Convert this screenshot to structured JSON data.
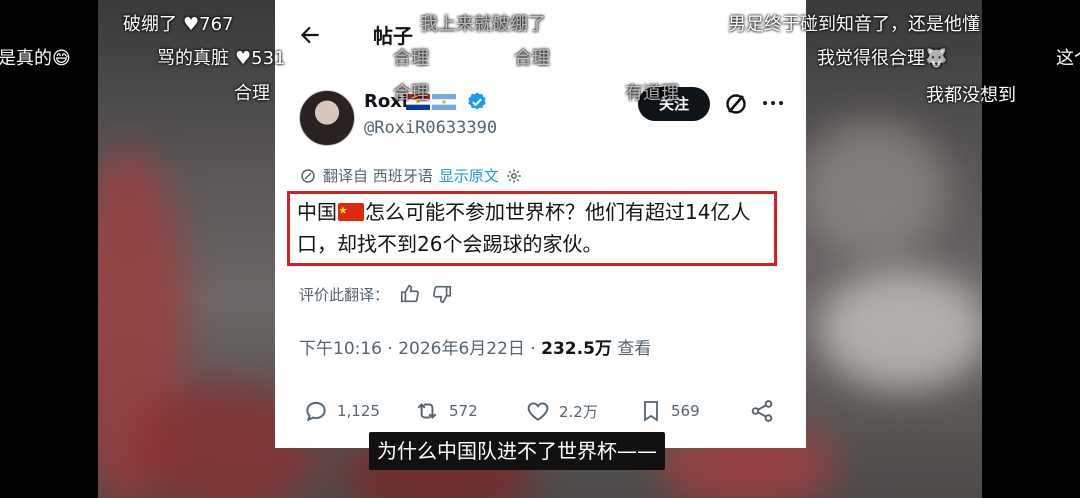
{
  "header": {
    "title": "帖子"
  },
  "tweet": {
    "display_name": "Roxi",
    "handle": "@RoxiR0633390",
    "follow_label": "关注",
    "translated_from": "翻译自 西班牙语",
    "show_original": "显示原文",
    "text_part1": "中国",
    "text_part2": "怎么可能不参加世界杯？他们有超过14亿人口，却找不到26个会踢球的家伙。",
    "rate_translation": "评价此翻译：",
    "time": "下午10:16 · 2026年6月22日 · ",
    "views_count": "232.5万",
    "views_label": " 查看",
    "stats": {
      "replies": "1,125",
      "reposts": "572",
      "likes": "2.2万",
      "bookmarks": "569"
    }
  },
  "danmaku": [
    {
      "text": "破绷了",
      "likes": "767"
    },
    {
      "text": "我上来就破绷了"
    },
    {
      "text": "男足终于碰到知音了，还是他懂"
    },
    {
      "text": "是真的😅"
    },
    {
      "text": "骂的真脏",
      "likes": "531"
    },
    {
      "text": "合理"
    },
    {
      "text": "合理"
    },
    {
      "text": "我觉得很合理🐺"
    },
    {
      "text": "这个"
    },
    {
      "text": "合理"
    },
    {
      "text": "合理"
    },
    {
      "text": "有道理"
    },
    {
      "text": "我都没想到"
    }
  ],
  "subtitle": "为什么中国队进不了世界杯——",
  "colors": {
    "highlight_box": "#d8211f",
    "link": "#1d9bf0",
    "verified": "#1d9bf0"
  }
}
